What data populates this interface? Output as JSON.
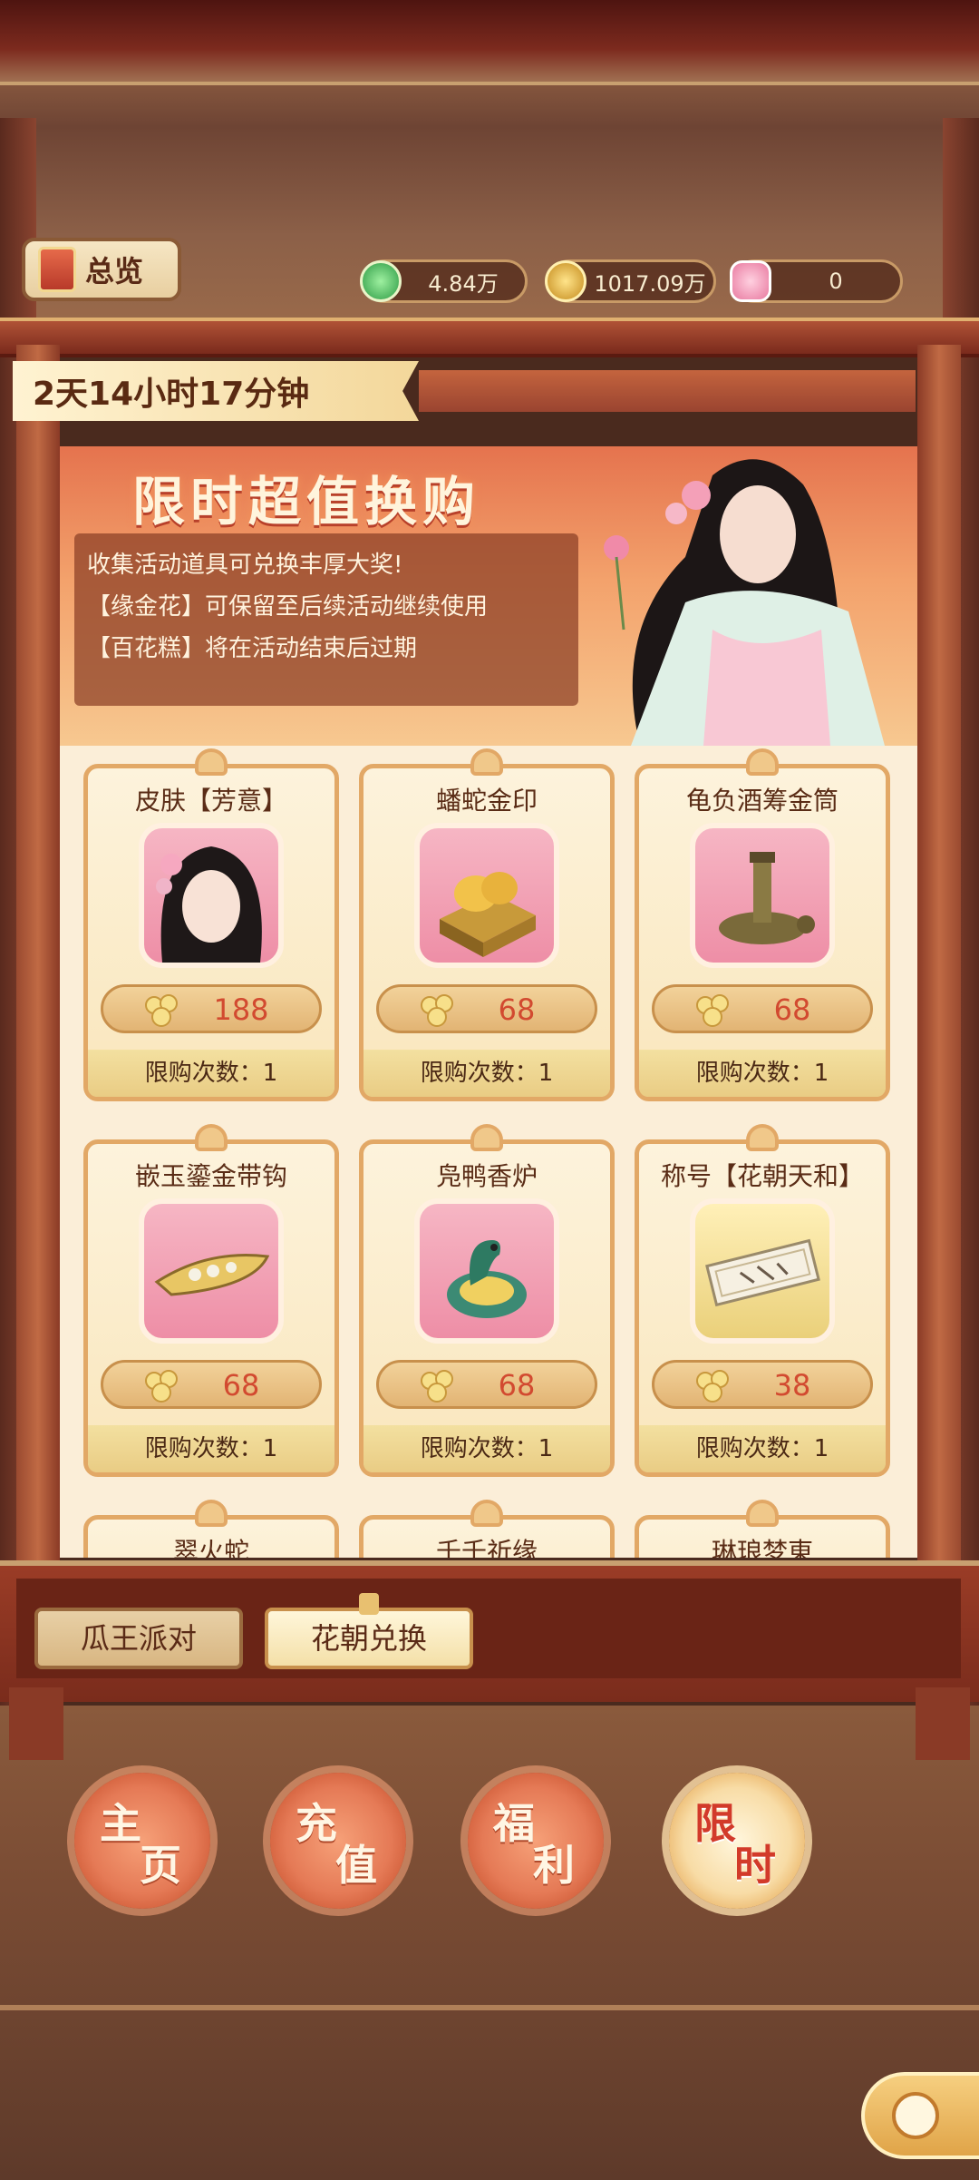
{
  "header": {
    "overview_label": "总览",
    "resources": [
      {
        "icon": "jade-coin-icon",
        "value": "4.84万"
      },
      {
        "icon": "copper-coin-icon",
        "value": "1017.09万"
      },
      {
        "icon": "flower-cake-icon",
        "value": "0"
      }
    ]
  },
  "event": {
    "timer": "2天14小时17分钟",
    "title": "限时超值换购",
    "description": [
      "收集活动道具可兑换丰厚大奖!",
      "【缘金花】可保留至后续活动继续使用",
      "【百花糕】将在活动结束后过期"
    ]
  },
  "items": [
    {
      "name": "皮肤【芳意】",
      "price": "188",
      "limit": "限购次数：1",
      "icon": "skin-portrait-icon"
    },
    {
      "name": "蟠蛇金印",
      "price": "68",
      "limit": "限购次数：1",
      "icon": "gold-seal-icon"
    },
    {
      "name": "龟负酒筹金筒",
      "price": "68",
      "limit": "限购次数：1",
      "icon": "turtle-vessel-icon"
    },
    {
      "name": "嵌玉鎏金带钩",
      "price": "68",
      "limit": "限购次数：1",
      "icon": "jade-belt-hook-icon"
    },
    {
      "name": "凫鸭香炉",
      "price": "68",
      "limit": "限购次数：1",
      "icon": "duck-censer-icon"
    },
    {
      "name": "称号【花朝天和】",
      "price": "38",
      "limit": "限购次数：1",
      "icon": "title-scroll-icon"
    },
    {
      "name": "翠火蛇",
      "price": "",
      "limit": "",
      "icon": ""
    },
    {
      "name": "千千祈缘",
      "price": "",
      "limit": "",
      "icon": ""
    },
    {
      "name": "琳琅梦東",
      "price": "",
      "limit": "",
      "icon": ""
    }
  ],
  "subtabs": [
    "瓜王派对",
    "花朝兑换"
  ],
  "nav": [
    {
      "top": "主",
      "bottom": "页"
    },
    {
      "top": "充",
      "bottom": "值"
    },
    {
      "top": "福",
      "bottom": "利"
    },
    {
      "top": "限",
      "bottom": "时"
    }
  ],
  "colors": {
    "accent": "#d24a30",
    "frame": "#9a4430",
    "panel": "#fbeed8"
  }
}
